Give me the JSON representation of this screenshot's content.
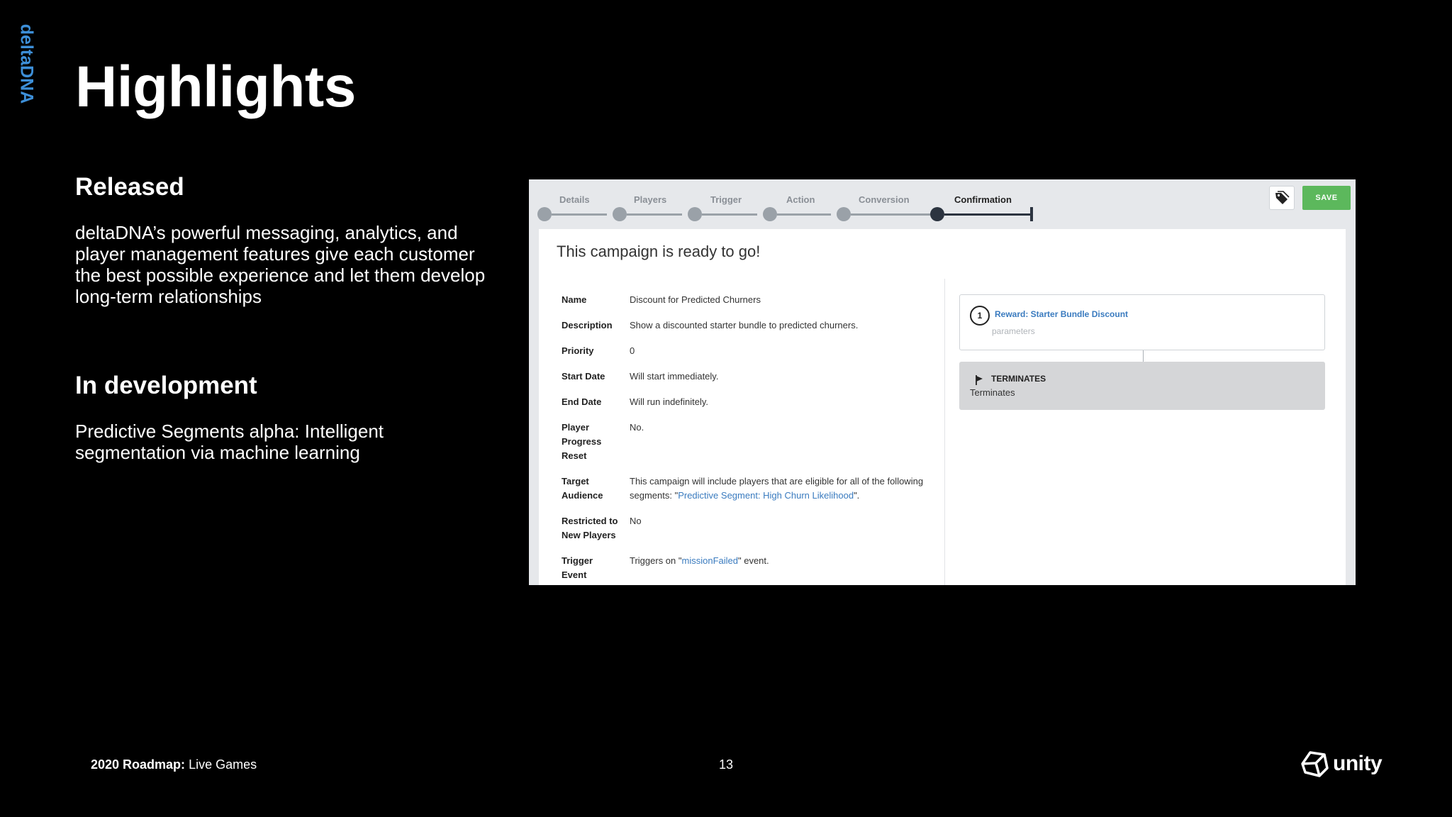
{
  "slide": {
    "brand": "deltaDNA",
    "title": "Highlights",
    "released_heading": "Released",
    "released_text": "deltaDNA’s powerful messaging, analytics, and player management features give each customer the best possible experience and let them develop long-term relationships",
    "dev_heading": "In development",
    "dev_text": "Predictive Segments alpha: Intelligent segmentation via machine learning",
    "footer_bold": "2020 Roadmap:",
    "footer_rest": " Live Games",
    "page_number": "13",
    "logo_text": "unity"
  },
  "screenshot": {
    "steps": [
      "Details",
      "Players",
      "Trigger",
      "Action",
      "Conversion",
      "Confirmation"
    ],
    "active_step": "Confirmation",
    "save_label": "SAVE",
    "heading": "This campaign is ready to go!",
    "details": [
      {
        "label": "Name",
        "value": "Discount for Predicted Churners"
      },
      {
        "label": "Description",
        "value": "Show a discounted starter bundle to predicted churners."
      },
      {
        "label": "Priority",
        "value": "0"
      },
      {
        "label": "Start Date",
        "value": "Will start immediately."
      },
      {
        "label": "End Date",
        "value": "Will run indefinitely."
      },
      {
        "label": "Player Progress Reset",
        "value": "No."
      },
      {
        "label": "Target Audience",
        "value_pre": "This campaign will include players that are eligible for all of the following segments: \"",
        "value_link": "Predictive Segment: High Churn Likelihood",
        "value_post": "\"."
      },
      {
        "label": "Restricted to New Players",
        "value": "No"
      },
      {
        "label": "Trigger Event",
        "value_pre": "Triggers on \"",
        "value_link": "missionFailed",
        "value_post": "\" event."
      }
    ],
    "reward": {
      "number": "1",
      "title": "Reward: Starter Bundle Discount",
      "subtitle": "parameters"
    },
    "terminates": {
      "title": "TERMINATES",
      "subtitle": "Terminates"
    }
  },
  "colors": {
    "brand_blue": "#3d8fd8",
    "save_green": "#5cb85c",
    "link_blue": "#3a7bbf"
  }
}
